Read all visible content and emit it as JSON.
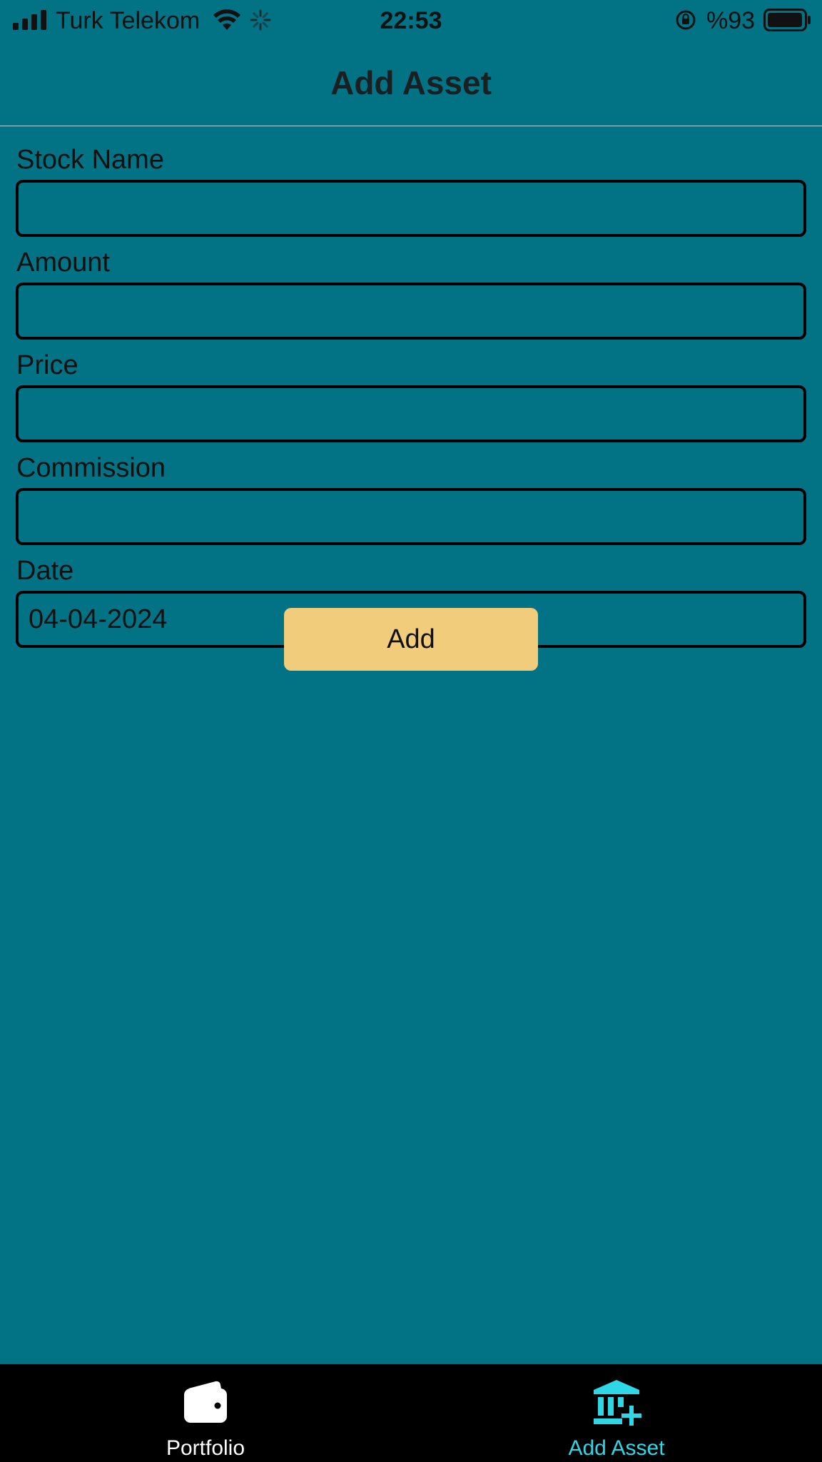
{
  "status_bar": {
    "carrier": "Turk Telekom",
    "time": "22:53",
    "battery_percent": "%93"
  },
  "header": {
    "title": "Add Asset"
  },
  "form": {
    "fields": [
      {
        "label": "Stock Name",
        "value": ""
      },
      {
        "label": "Amount",
        "value": ""
      },
      {
        "label": "Price",
        "value": ""
      },
      {
        "label": "Commission",
        "value": ""
      },
      {
        "label": "Date",
        "value": "04-04-2024"
      }
    ],
    "submit_label": "Add"
  },
  "tab_bar": {
    "tabs": [
      {
        "label": "Portfolio",
        "icon": "wallet-icon",
        "active": false
      },
      {
        "label": "Add Asset",
        "icon": "bank-add-icon",
        "active": true
      }
    ]
  },
  "colors": {
    "background": "#027285",
    "button": "#F1CC7B",
    "tab_bar": "#000000",
    "active_tab": "#2FD6E6",
    "inactive_tab": "#FFFFFF"
  }
}
